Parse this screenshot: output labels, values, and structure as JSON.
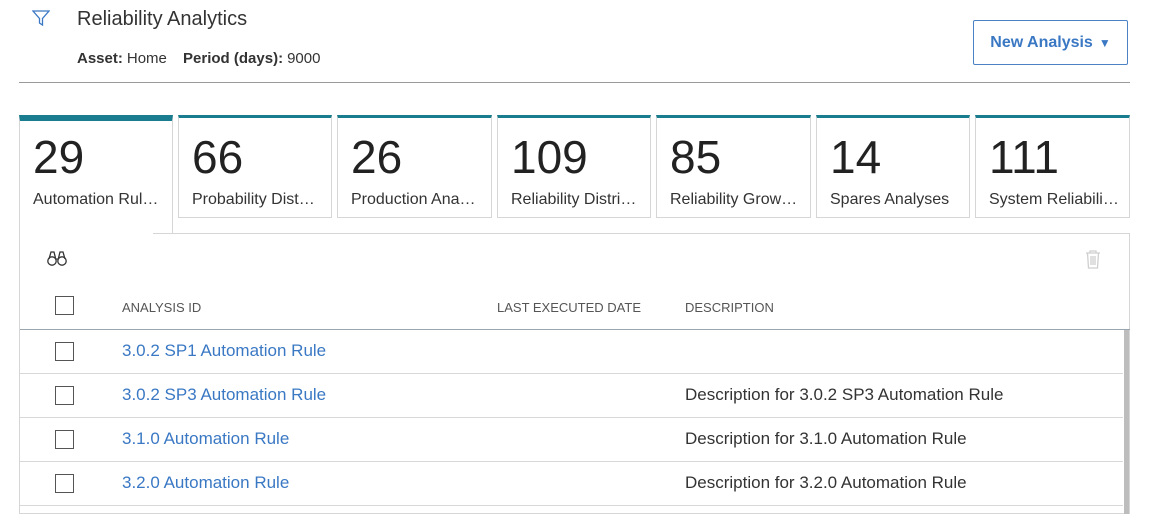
{
  "header": {
    "title": "Reliability Analytics",
    "asset_label": "Asset:",
    "asset_value": "Home",
    "period_label": "Period (days):",
    "period_value": "9000",
    "new_analysis_label": "New Analysis"
  },
  "colors": {
    "accent_teal": "#1a7d8f",
    "link_blue": "#3a78c4"
  },
  "tabs": [
    {
      "count": "29",
      "label": "Automation Rul…",
      "active": true
    },
    {
      "count": "66",
      "label": "Probability Dist…"
    },
    {
      "count": "26",
      "label": "Production Ana…"
    },
    {
      "count": "109",
      "label": "Reliability Distri…"
    },
    {
      "count": "85",
      "label": "Reliability Grow…"
    },
    {
      "count": "14",
      "label": "Spares Analyses"
    },
    {
      "count": "111",
      "label": "System Reliabili…"
    }
  ],
  "table": {
    "columns": [
      "ANALYSIS ID",
      "LAST EXECUTED DATE",
      "DESCRIPTION"
    ],
    "rows": [
      {
        "id": "3.0.2 SP1 Automation Rule",
        "last_executed": "",
        "description": ""
      },
      {
        "id": "3.0.2 SP3 Automation Rule",
        "last_executed": "",
        "description": "Description for 3.0.2 SP3 Automation Rule"
      },
      {
        "id": "3.1.0 Automation Rule",
        "last_executed": "",
        "description": "Description for 3.1.0 Automation Rule"
      },
      {
        "id": "3.2.0 Automation Rule",
        "last_executed": "",
        "description": "Description for 3.2.0 Automation Rule"
      }
    ]
  },
  "icons": {
    "filter": "filter-icon",
    "search": "binoculars-icon",
    "delete": "trash-icon",
    "dropdown": "caret-down-icon"
  }
}
